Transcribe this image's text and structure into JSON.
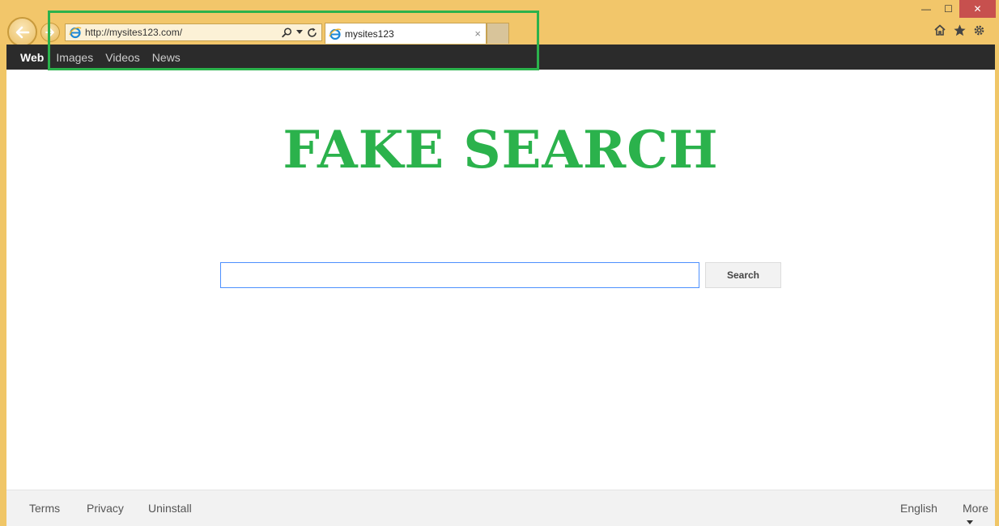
{
  "browser": {
    "address_url": "http://mysites123.com/",
    "tab_title": "mysites123",
    "tab_close": "×",
    "window_controls": {
      "minimize": "—",
      "maximize": "☐",
      "close": "✕"
    },
    "icons": {
      "back": "back-arrow-icon",
      "forward": "forward-arrow-icon",
      "search": "search-icon",
      "dropdown": "dropdown-caret-icon",
      "refresh": "refresh-icon",
      "home": "home-icon",
      "favorites": "star-icon",
      "settings": "gear-icon"
    }
  },
  "page_nav": {
    "items": [
      {
        "label": "Web",
        "active": true
      },
      {
        "label": "Images"
      },
      {
        "label": "Videos"
      },
      {
        "label": "News"
      }
    ]
  },
  "main": {
    "logo_text": "FAKE SEARCH",
    "search_placeholder": "",
    "search_button_label": "Search"
  },
  "footer": {
    "left_links": [
      "Terms",
      "Privacy",
      "Uninstall"
    ],
    "language": "English",
    "more": "More"
  },
  "colors": {
    "brand_green": "#2bb24c",
    "chrome_bg": "#f2c66a",
    "nav_bg": "#2b2b2b",
    "input_border": "#4d90fe",
    "close_button": "#c7504e"
  }
}
